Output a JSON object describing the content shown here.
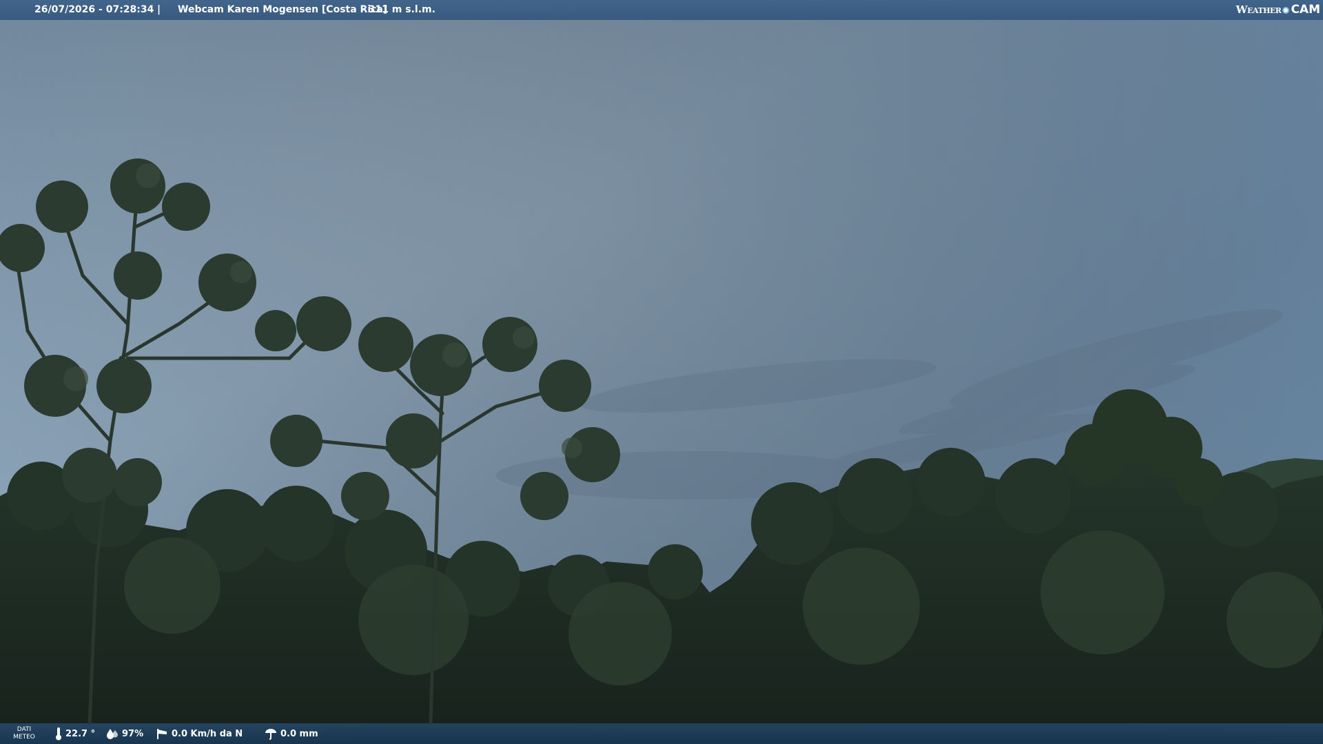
{
  "header": {
    "datetime": "26/07/2026 - 07:28:34",
    "separator": "|",
    "title": "Webcam Karen Mogensen [Costa Rica]",
    "altitude": "- 311 m s.l.m.",
    "logo_left": "Weather",
    "logo_right": "CAM"
  },
  "footer": {
    "label_line1": "DATI",
    "label_line2": "METEO",
    "temperature": "22.7 °",
    "humidity": "97%",
    "wind": "0.0 Km/h da N",
    "rain": "0.0 mm"
  },
  "icons": {
    "temperature": "thermometer-icon",
    "humidity": "humidity-drops-icon",
    "wind": "wind-sock-icon",
    "rain": "rain-gauge-icon"
  },
  "colors": {
    "bar": "#3e628a",
    "footer_bar": "#1c3c58",
    "sky": "#7f97ad",
    "forest": "#1e2c22"
  }
}
